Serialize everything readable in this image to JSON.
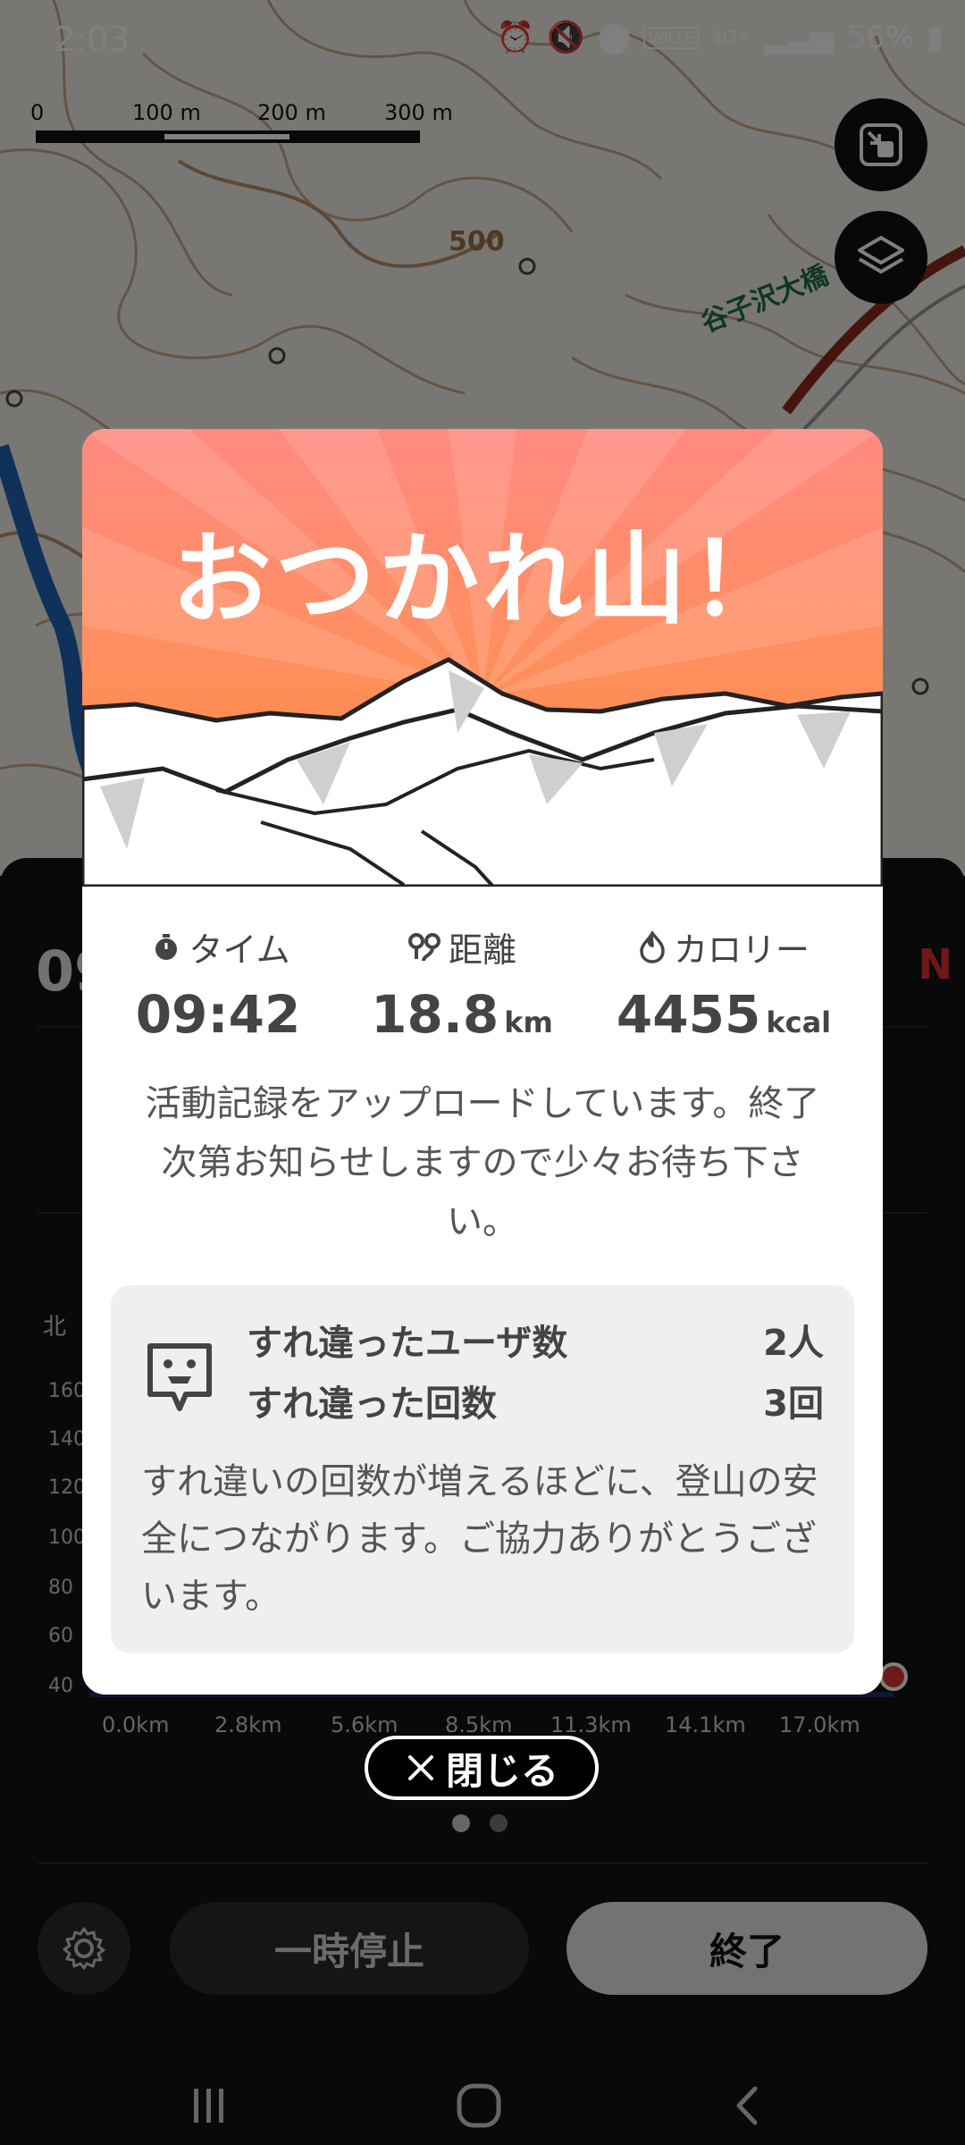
{
  "status_bar": {
    "time": "2:03",
    "network": "4G+",
    "volte": "VoLTE",
    "battery": "56%"
  },
  "map": {
    "scale_labels": [
      "0",
      "100 m",
      "200 m",
      "300 m"
    ],
    "contour_label": "500",
    "place_label": "谷子沢大橋"
  },
  "background_panel": {
    "elapsed_time": "09",
    "compass_letter": "N",
    "chart": {
      "y_ticks": [
        "160",
        "140",
        "120",
        "100",
        "80",
        "60",
        "40"
      ],
      "x_ticks": [
        "0.0km",
        "2.8km",
        "5.6km",
        "8.5km",
        "11.3km",
        "14.1km",
        "17.0km"
      ],
      "axis_prefix": "北"
    },
    "pause_label": "一時停止",
    "end_label": "終了"
  },
  "modal": {
    "title": "おつかれ山！",
    "stats": [
      {
        "label": "タイム",
        "value": "09:42",
        "unit": ""
      },
      {
        "label": "距離",
        "value": "18.8",
        "unit": "km"
      },
      {
        "label": "カロリー",
        "value": "4455",
        "unit": "kcal"
      }
    ],
    "upload_message": "活動記録をアップロードしています。終了次第お知らせしますので少々お待ち下さい。",
    "encounter": {
      "users_label": "すれ違ったユーザ数",
      "users_value": "2人",
      "count_label": "すれ違った回数",
      "count_value": "3回",
      "note": "すれ違いの回数が増えるほどに、登山の安全につながります。ご協力ありがとうございます。"
    }
  },
  "close_button": {
    "label": "閉じる"
  },
  "colors": {
    "hero_top": "#ff8a80",
    "hero_bottom": "#f57a2a",
    "accent_red": "#d33333"
  }
}
